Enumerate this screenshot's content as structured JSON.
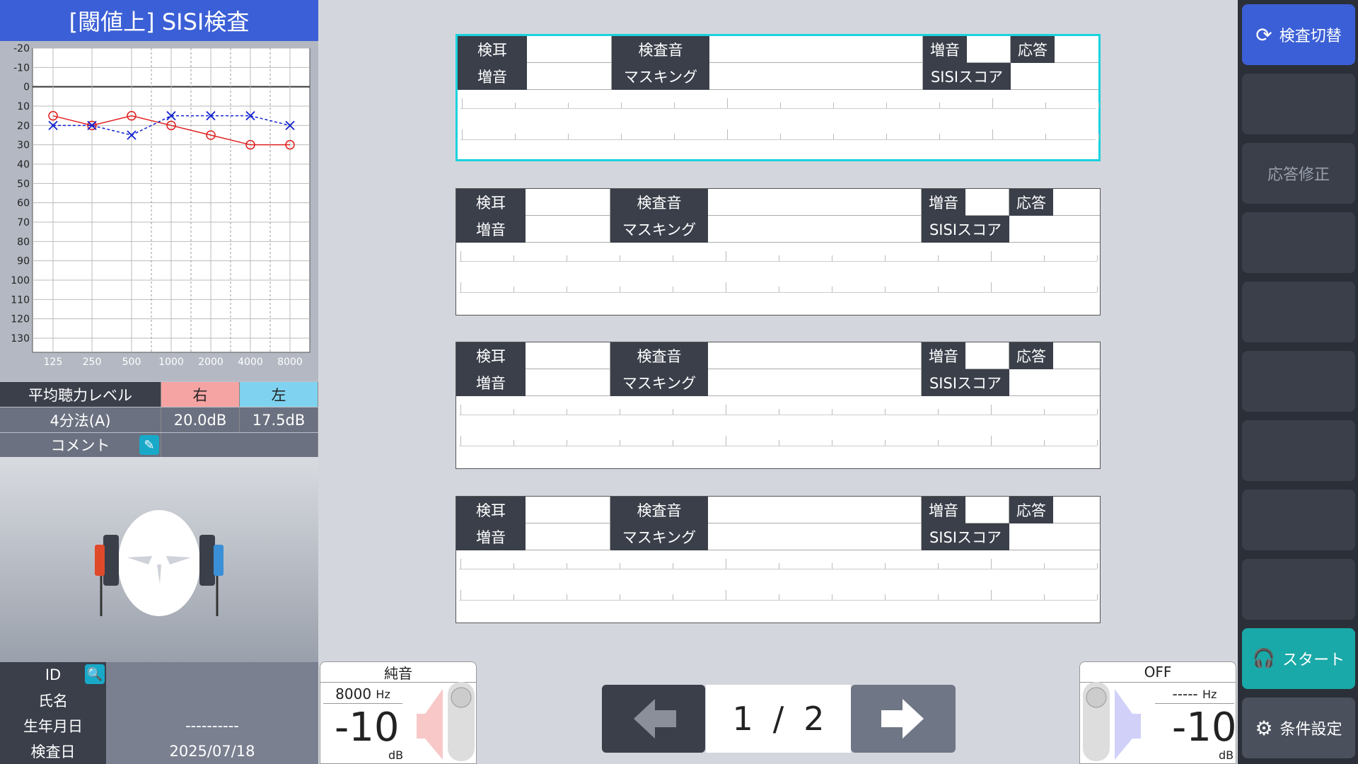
{
  "title": "[閾値上] SISI検査",
  "audiogram": {
    "y_ticks": [
      "-20",
      "-10",
      "0",
      "10",
      "20",
      "30",
      "40",
      "50",
      "60",
      "70",
      "80",
      "90",
      "100",
      "110",
      "120",
      "130"
    ],
    "x_ticks": [
      "125",
      "250",
      "500",
      "1000",
      "2000",
      "4000",
      "8000"
    ],
    "right_ear": [
      15,
      20,
      15,
      20,
      25,
      30,
      30
    ],
    "left_ear": [
      20,
      20,
      25,
      15,
      15,
      15,
      20
    ],
    "right_color": "#e02020",
    "left_color": "#1020d0"
  },
  "avg": {
    "label": "平均聴力レベル",
    "right_label": "右",
    "left_label": "左",
    "method": "4分法(A)",
    "right_value": "20.0dB",
    "left_value": "17.5dB",
    "comment_label": "コメント",
    "right_bg": "#f6a3a3",
    "left_bg": "#7fd3f0"
  },
  "patient": {
    "id_label": "ID",
    "id_value": "",
    "name_label": "氏名",
    "name_value": "",
    "dob_label": "生年月日",
    "dob_value": "----------",
    "date_label": "検査日",
    "date_value": "2025/07/18"
  },
  "panel_labels": {
    "ear": "検耳",
    "tone": "検査音",
    "inc": "増音",
    "resp": "応答",
    "inc2": "増音",
    "masking": "マスキング",
    "score": "SISIスコア"
  },
  "sidebar": {
    "switch": "検査切替",
    "correct": "応答修正",
    "start": "スタート",
    "settings": "条件設定"
  },
  "left_widget": {
    "type": "純音",
    "freq": "8000",
    "freq_unit": "Hz",
    "level": "-10",
    "unit": "dB"
  },
  "right_widget": {
    "type": "OFF",
    "freq": "-----",
    "freq_unit": "Hz",
    "level": "-10",
    "unit": "dB"
  },
  "pager": {
    "current": "1",
    "sep": "/",
    "total": "2"
  }
}
